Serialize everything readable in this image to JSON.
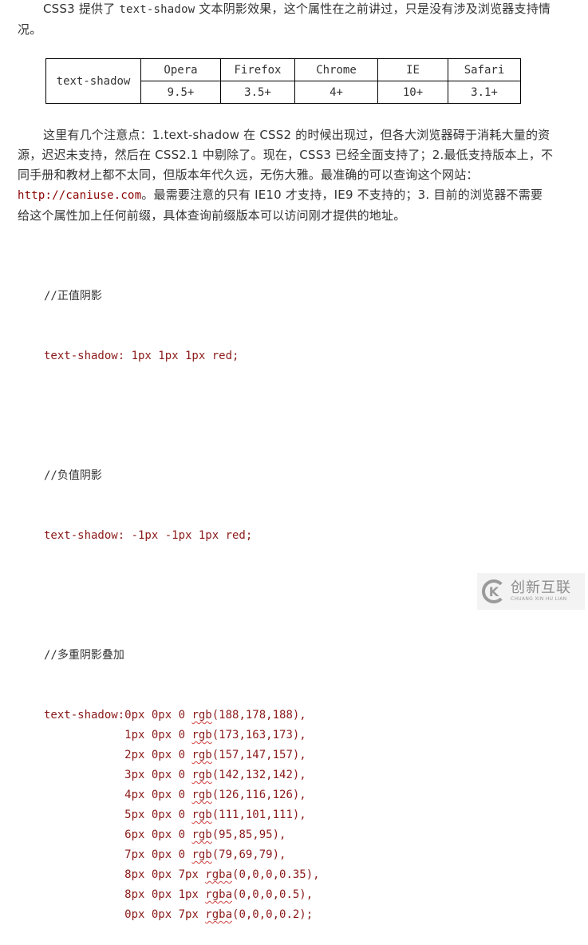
{
  "intro": {
    "prefix": "CSS3 提供了 ",
    "code": "text-shadow",
    "suffix": " 文本阴影效果，这个属性在之前讲过，只是没有涉及浏览器支持情况。"
  },
  "support_table": {
    "property": "text-shadow",
    "browsers": [
      "Opera",
      "Firefox",
      "Chrome",
      "IE",
      "Safari"
    ],
    "versions": [
      "9.5+",
      "3.5+",
      "4+",
      "10+",
      "3.1+"
    ]
  },
  "notes": {
    "part1": "这里有几个注意点：1.text-shadow 在 CSS2 的时候出现过，但各大浏览器碍于消耗大量的资源，迟迟未支持，然后在 CSS2.1 中剔除了。现在，CSS3 已经全面支持了；2.最低支持版本上，不同手册和教材上都不太同，但版本年代久远，无伤大雅。最准确的可以查询这个网站：",
    "link": "http://caniuse.com",
    "part2": "。最需要注意的只有 IE10 才支持，IE9 不支持的；3. 目前的浏览器不需要给这个属性加上任何前缀，具体查询前缀版本可以访问刚才提供的地址。"
  },
  "code": {
    "positive_comment": "//正值阴影",
    "positive_line": "text-shadow: 1px 1px 1px red;",
    "negative_comment": "//负值阴影",
    "negative_line": "text-shadow: -1px -1px 1px red;",
    "multi_comment": "//多重阴影叠加",
    "multi_lines": [
      {
        "prefix": "text-shadow:0px 0px 0 ",
        "fn": "rgb",
        "args": "(188,178,188),"
      },
      {
        "prefix": "            1px 0px 0 ",
        "fn": "rgb",
        "args": "(173,163,173),"
      },
      {
        "prefix": "            2px 0px 0 ",
        "fn": "rgb",
        "args": "(157,147,157),"
      },
      {
        "prefix": "            3px 0px 0 ",
        "fn": "rgb",
        "args": "(142,132,142),"
      },
      {
        "prefix": "            4px 0px 0 ",
        "fn": "rgb",
        "args": "(126,116,126),"
      },
      {
        "prefix": "            5px 0px 0 ",
        "fn": "rgb",
        "args": "(111,101,111),"
      },
      {
        "prefix": "            6px 0px 0 ",
        "fn": "rgb",
        "args": "(95,85,95),"
      },
      {
        "prefix": "            7px 0px 0 ",
        "fn": "rgb",
        "args": "(79,69,79),"
      },
      {
        "prefix": "            8px 0px 7px ",
        "fn": "rgba",
        "args": "(0,0,0,0.35),"
      },
      {
        "prefix": "            8px 0px 1px ",
        "fn": "rgba",
        "args": "(0,0,0,0.5),"
      },
      {
        "prefix": "            0px 0px 7px ",
        "fn": "rgba",
        "args": "(0,0,0,0.2);"
      }
    ]
  },
  "watermark": {
    "logo_letter": "K",
    "name_cn": "创新互联",
    "name_en": "CHUANG XIN HU LIAN"
  }
}
